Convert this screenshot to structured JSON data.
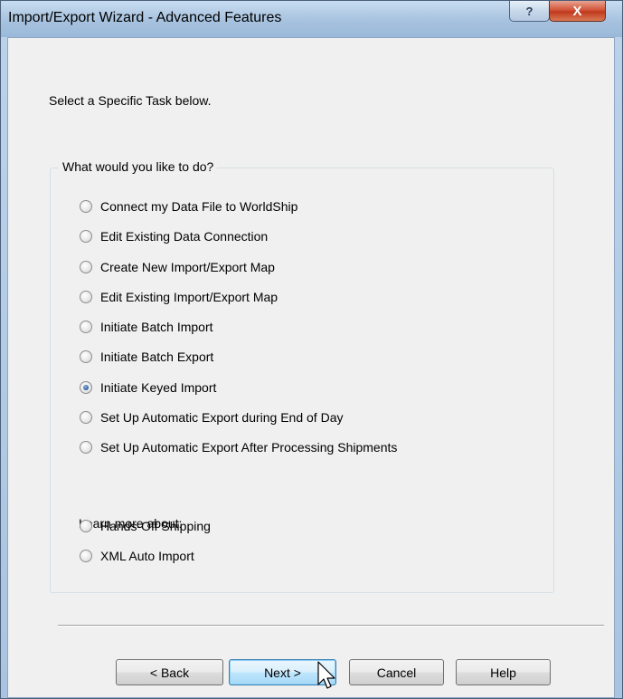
{
  "window": {
    "title": "Import/Export Wizard - Advanced Features",
    "help_glyph": "?",
    "close_glyph": "X"
  },
  "instruction": "Select a Specific Task below.",
  "group": {
    "legend": "What would you like to do?",
    "options": [
      {
        "label": "Connect my Data File to WorldShip",
        "checked": false
      },
      {
        "label": "Edit Existing Data Connection",
        "checked": false
      },
      {
        "label": "Create New Import/Export Map",
        "checked": false
      },
      {
        "label": "Edit Existing Import/Export Map",
        "checked": false
      },
      {
        "label": "Initiate Batch Import",
        "checked": false
      },
      {
        "label": "Initiate Batch Export",
        "checked": false
      },
      {
        "label": "Initiate Keyed Import",
        "checked": true
      },
      {
        "label": "Set Up Automatic Export during End of Day",
        "checked": false
      },
      {
        "label": "Set Up Automatic Export After Processing Shipments",
        "checked": false
      }
    ],
    "learn_more_label": "Learn more about:",
    "learn_options": [
      {
        "label": "Hands-Off Shipping",
        "checked": false
      },
      {
        "label": "XML Auto Import",
        "checked": false
      }
    ]
  },
  "buttons": {
    "back": "< Back",
    "next": "Next >",
    "cancel": "Cancel",
    "help": "Help"
  }
}
